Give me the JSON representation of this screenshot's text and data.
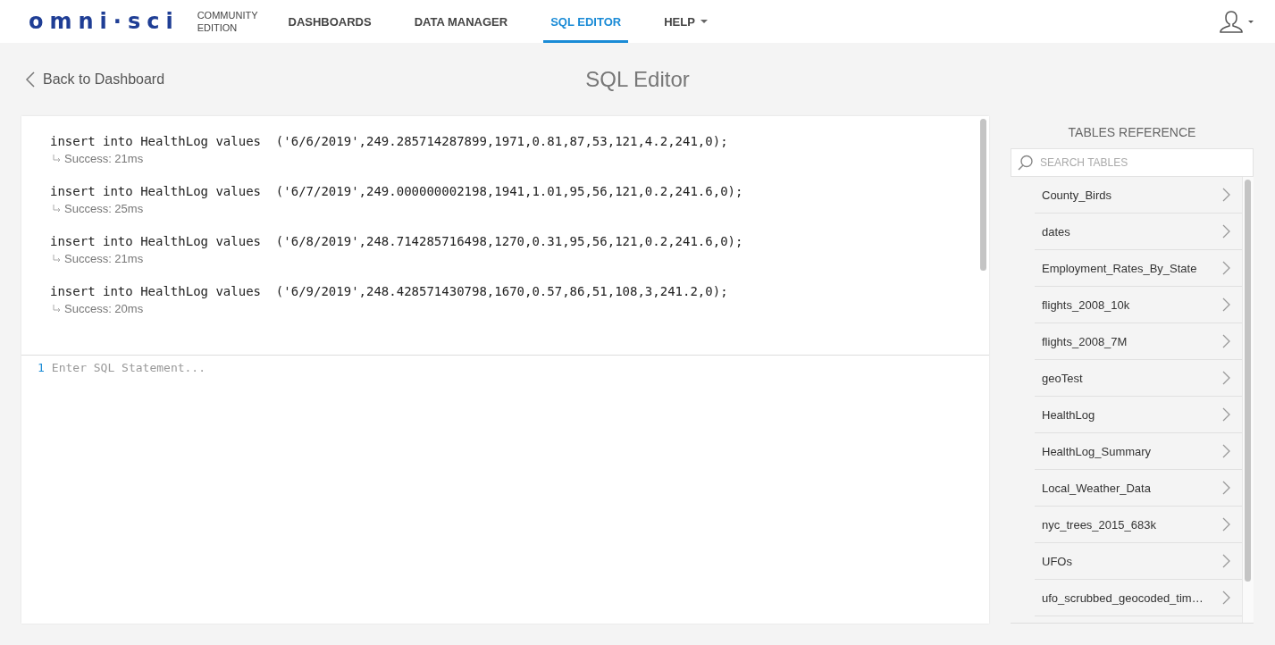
{
  "header": {
    "logo": "omni·sci",
    "edition": [
      "COMMUNITY",
      "EDITION"
    ],
    "nav": [
      {
        "label": "DASHBOARDS",
        "selected": false,
        "dropdown": false
      },
      {
        "label": "DATA MANAGER",
        "selected": false,
        "dropdown": false
      },
      {
        "label": "SQL EDITOR",
        "selected": true,
        "dropdown": false
      },
      {
        "label": "HELP",
        "selected": false,
        "dropdown": true
      }
    ]
  },
  "back_link": "Back to Dashboard",
  "page_title": "SQL Editor",
  "results": [
    {
      "statement": "insert into HealthLog values  ('6/6/2019',249.285714287899,1971,0.81,87,53,121,4.2,241,0);",
      "status": "Success: 21ms"
    },
    {
      "statement": "insert into HealthLog values  ('6/7/2019',249.000000002198,1941,1.01,95,56,121,0.2,241.6,0);",
      "status": "Success: 25ms"
    },
    {
      "statement": "insert into HealthLog values  ('6/8/2019',248.714285716498,1270,0.31,95,56,121,0.2,241.6,0);",
      "status": "Success: 21ms"
    },
    {
      "statement": "insert into HealthLog values  ('6/9/2019',248.428571430798,1670,0.57,86,51,108,3,241.2,0);",
      "status": "Success: 20ms"
    }
  ],
  "editor": {
    "line_number": "1",
    "placeholder": "Enter SQL Statement..."
  },
  "tables_reference": {
    "title": "TABLES REFERENCE",
    "search": {
      "placeholder": "SEARCH TABLES"
    },
    "tables": [
      "County_Birds",
      "dates",
      "Employment_Rates_By_State",
      "flights_2008_10k",
      "flights_2008_7M",
      "geoTest",
      "HealthLog",
      "HealthLog_Summary",
      "Local_Weather_Data",
      "nyc_trees_2015_683k",
      "UFOs",
      "ufo_scrubbed_geocoded_tim…"
    ]
  }
}
